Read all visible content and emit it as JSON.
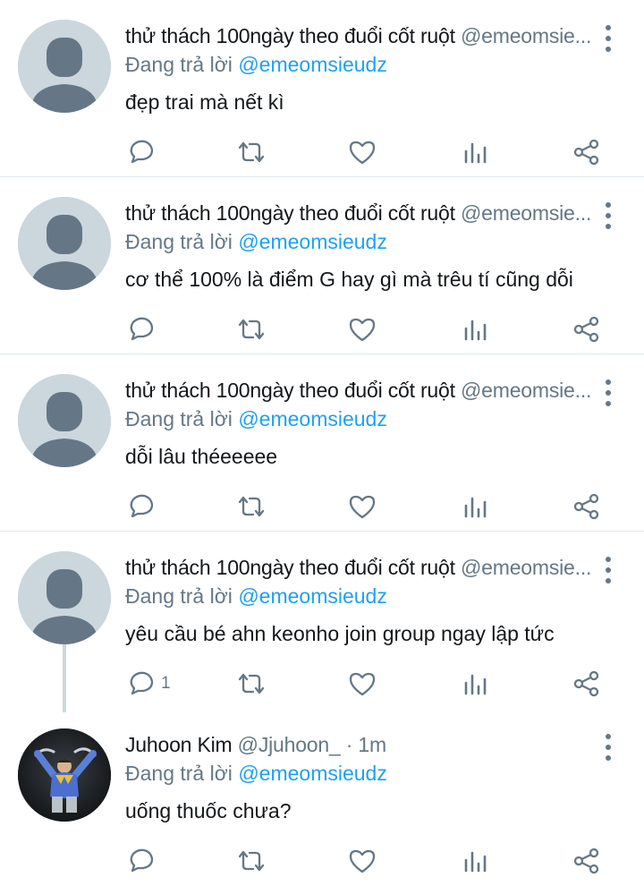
{
  "tweets": [
    {
      "name": "thử thách 100ngày theo đuổi cốt ruột",
      "handle": "@emeomsie...",
      "reply_prefix": "Đang trả lời",
      "reply_to": "@emeomsieudz",
      "text": "đẹp trai mà nết kì",
      "avatar": "default-avatar-icon",
      "reply_count": ""
    },
    {
      "name": "thử thách 100ngày theo đuổi cốt ruột",
      "handle": "@emeomsie...",
      "reply_prefix": "Đang trả lời",
      "reply_to": "@emeomsieudz",
      "text": "cơ thể 100% là điểm G hay gì mà trêu tí cũng dỗi",
      "avatar": "default-avatar-icon",
      "reply_count": ""
    },
    {
      "name": "thử thách 100ngày theo đuổi cốt ruột",
      "handle": "@emeomsie...",
      "reply_prefix": "Đang trả lời",
      "reply_to": "@emeomsieudz",
      "text": "dỗi lâu théeeeee",
      "avatar": "default-avatar-icon",
      "reply_count": ""
    },
    {
      "name": "thử thách 100ngày theo đuổi cốt ruột",
      "handle": "@emeomsie...",
      "reply_prefix": "Đang trả lời",
      "reply_to": "@emeomsieudz",
      "text": "yêu cầu bé ahn keonho join group ngay lập tức",
      "avatar": "default-avatar-icon",
      "reply_count": "1"
    },
    {
      "name": "Juhoon Kim",
      "handle": "@Jjuhoon_ · 1m",
      "reply_prefix": "Đang trả lời",
      "reply_to": "@emeomsieudz",
      "text": "uống thuốc chưa?",
      "avatar": "photo-avatar",
      "reply_count": ""
    }
  ],
  "colors": {
    "link": "#1da1f2",
    "muted": "#657786",
    "text": "#14171a",
    "divider": "#e1e8ed",
    "avatar_bg": "#ccd6dd",
    "avatar_fg": "#657786"
  },
  "icons": [
    "reply-icon",
    "retweet-icon",
    "like-icon",
    "stats-icon",
    "share-icon",
    "more-icon"
  ]
}
